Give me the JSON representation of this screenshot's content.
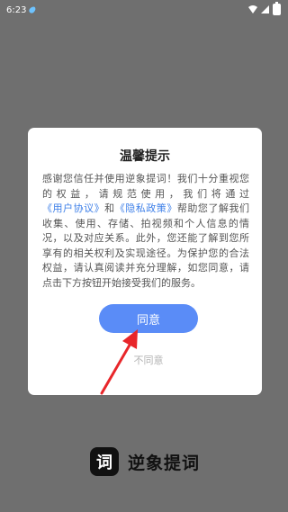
{
  "status_bar": {
    "time": "6:23",
    "icons": [
      "notification-drop-icon",
      "wifi-icon",
      "signal-icon",
      "battery-icon"
    ]
  },
  "dialog": {
    "title": "温馨提示",
    "body_before_link1": "感谢您信任并使用逆象提词！我们十分重视您的权益，请规范使用，我们将通过",
    "link_user_agreement": "《用户协议》",
    "body_and": "和",
    "link_privacy_policy": "《隐私政策》",
    "body_after_links": "帮助您了解我们收集、使用、存储、拍视频和个人信息的情况，以及对应关系。此外，您还能了解到您所享有的相关权利及实现途径。为保护您的合法权益，请认真阅读并充分理解，如您同意，请点击下方按钮开始接受我们的服务。",
    "agree_label": "同意",
    "disagree_label": "不同意"
  },
  "brand": {
    "logo_char": "词",
    "name": "逆象提词"
  },
  "colors": {
    "overlay": "#6f6f6f",
    "accent": "#5a8cf7",
    "link": "#3d7fe8",
    "annotation_arrow": "#e8262a"
  }
}
